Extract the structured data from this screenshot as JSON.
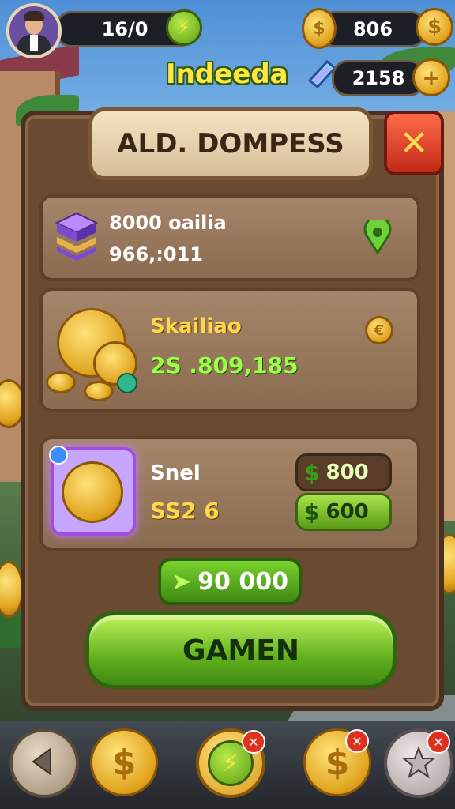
{
  "hud": {
    "energy_value": "16/0",
    "coins_value": "806",
    "gems_value": "2158",
    "game_title": "Indeeda"
  },
  "panel": {
    "title": "ALD. DOMPESS",
    "close_label": "✕"
  },
  "offers": [
    {
      "title": "8000 oailia",
      "subtitle": "966,:011",
      "action_icon": "location-pin-icon"
    },
    {
      "title": "Skailiao",
      "price": "2S .809,185",
      "action_icon": "euro-icon"
    },
    {
      "title": "Snel",
      "price": "SS2 6",
      "buy_options": [
        "800",
        "600"
      ]
    }
  ],
  "reward_amount": "90 000",
  "cta_label": "GAMEN",
  "bottom_nav": [
    {
      "icon": "back-arrow-icon"
    },
    {
      "icon": "dollar-coin-icon"
    },
    {
      "icon": "lightning-icon",
      "badge": "✕"
    },
    {
      "icon": "dollar-coin-icon",
      "badge": "✕"
    },
    {
      "icon": "star-icon",
      "badge": "✕"
    }
  ],
  "colors": {
    "panel_brown": "#6b4a32",
    "cta_green": "#63b01d",
    "close_red": "#c22a18",
    "title_yellow": "#ffe640"
  }
}
